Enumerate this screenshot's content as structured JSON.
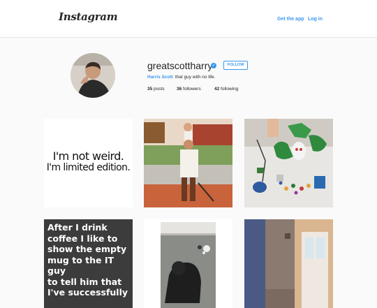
{
  "topbar": {
    "logo": "Instagram",
    "get_app": "Get the app",
    "login": "Log in"
  },
  "profile": {
    "username": "greatscottharry",
    "verified_badge": "✓",
    "follow_label": "FOLLOW",
    "full_name": "Harris Scott",
    "bio": "that guy with no life.",
    "stats": {
      "posts_count": "35",
      "posts_label": "posts",
      "followers_count": "36",
      "followers_label": "followers",
      "following_count": "42",
      "following_label": "following"
    }
  },
  "posts": {
    "post1_line1": "I'm not weird.",
    "post1_line2": "I'm limited edition.",
    "post4_lines": [
      "After I drink",
      "coffee I like to",
      "show the empty",
      "mug to the IT guy",
      "to tell him that",
      "I've successfully"
    ]
  },
  "colors": {
    "accent": "#3897f0",
    "background": "#fafafa",
    "text": "#262626"
  }
}
